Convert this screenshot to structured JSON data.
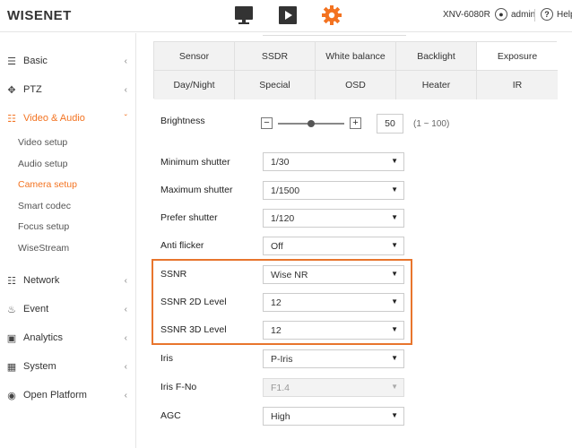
{
  "header": {
    "logo": "WISENET",
    "model": "XNV-6080R",
    "user": "admin",
    "help": "Help",
    "accent": "#f37321"
  },
  "sidebar": {
    "items": [
      {
        "label": "Basic",
        "icon": "list-icon"
      },
      {
        "label": "PTZ",
        "icon": "move-icon"
      },
      {
        "label": "Video & Audio",
        "icon": "sliders-icon"
      },
      {
        "label": "Network",
        "icon": "network-icon"
      },
      {
        "label": "Event",
        "icon": "bell-icon"
      },
      {
        "label": "Analytics",
        "icon": "frame-icon"
      },
      {
        "label": "System",
        "icon": "chip-icon"
      },
      {
        "label": "Open Platform",
        "icon": "platform-icon"
      }
    ],
    "sub_items": [
      "Video setup",
      "Audio setup",
      "Camera setup",
      "Smart codec",
      "Focus setup",
      "WiseStream"
    ]
  },
  "tabs": {
    "row1": [
      "Sensor",
      "SSDR",
      "White balance",
      "Backlight",
      "Exposure"
    ],
    "row2": [
      "Day/Night",
      "Special",
      "OSD",
      "Heater",
      "IR"
    ]
  },
  "form": {
    "brightness": {
      "label": "Brightness",
      "value": "50",
      "range": "(1 ~ 100)",
      "level": 0.5
    },
    "min_shutter": {
      "label": "Minimum shutter",
      "value": "1/30"
    },
    "max_shutter": {
      "label": "Maximum shutter",
      "value": "1/1500"
    },
    "prefer_shutter": {
      "label": "Prefer shutter",
      "value": "1/120"
    },
    "anti_flicker": {
      "label": "Anti flicker",
      "value": "Off"
    },
    "ssnr": {
      "label": "SSNR",
      "value": "Wise NR"
    },
    "ssnr_2d": {
      "label": "SSNR 2D Level",
      "value": "12"
    },
    "ssnr_3d": {
      "label": "SSNR 3D Level",
      "value": "12"
    },
    "iris": {
      "label": "Iris",
      "value": "P-Iris"
    },
    "iris_fno": {
      "label": "Iris F-No",
      "value": "F1.4"
    },
    "agc": {
      "label": "AGC",
      "value": "High"
    }
  }
}
